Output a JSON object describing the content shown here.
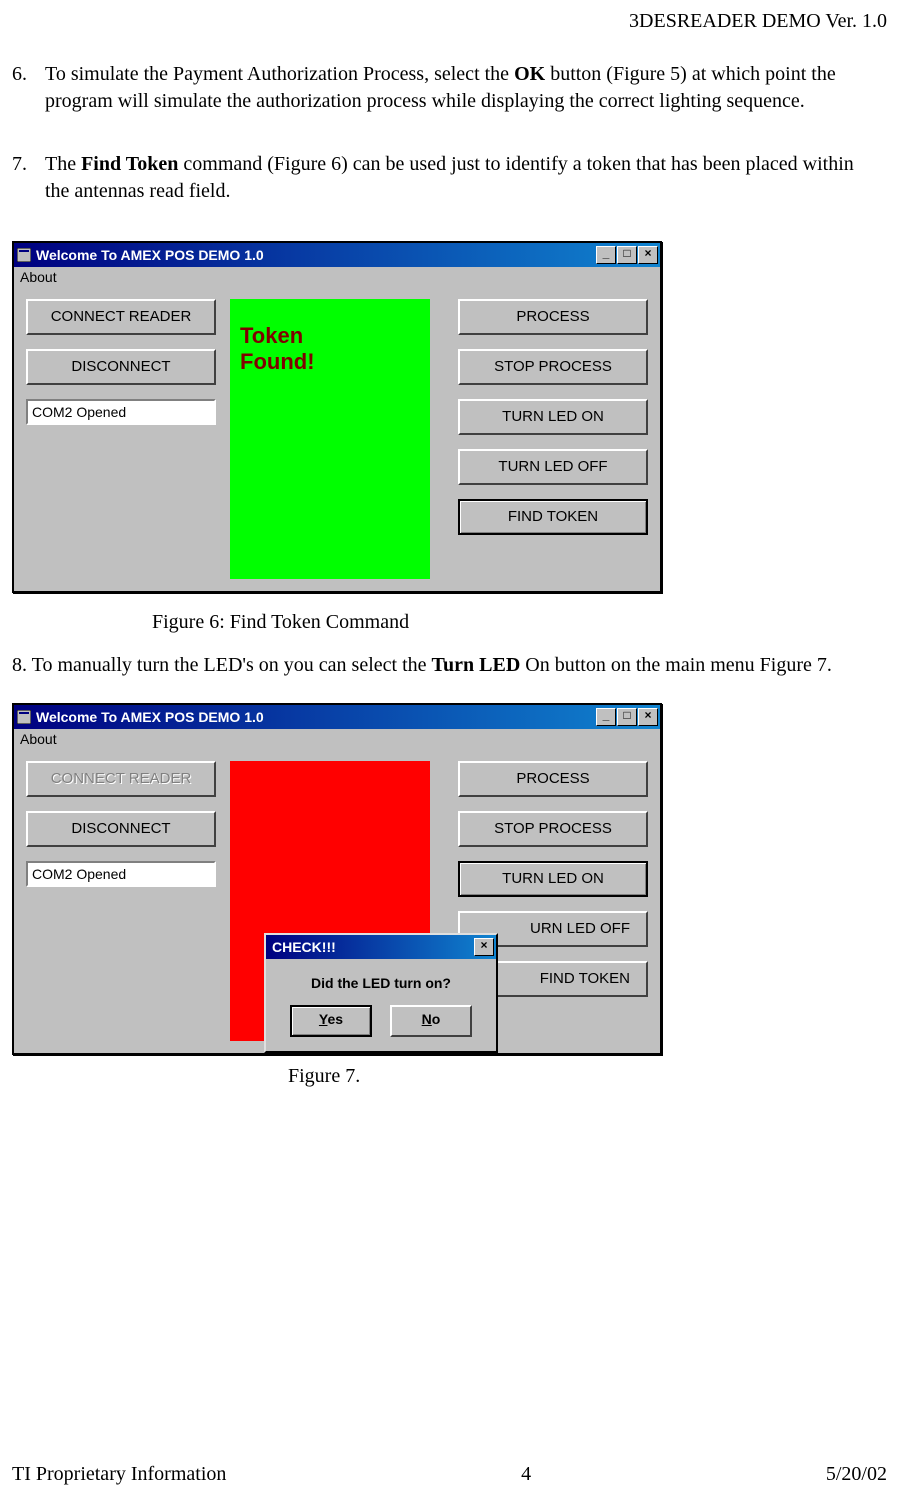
{
  "header": {
    "title": "3DESREADER DEMO Ver. 1.0"
  },
  "items": {
    "i6": {
      "num": "6.",
      "pre": "To simulate the Payment Authorization Process, select the ",
      "bold": "OK",
      "post": " button (Figure 5) at which point the program will simulate the authorization process while displaying the correct lighting sequence."
    },
    "i7": {
      "num": "7.",
      "pre": "The ",
      "bold": "Find Token",
      "post": " command (Figure 6) can be used just to identify a token that has been placed within the antennas read field."
    },
    "i8": {
      "num": "8.",
      "pre": "  To manually turn the LED's on you can select the ",
      "bold": "Turn LED",
      "post": " On button on the main menu Figure 7."
    }
  },
  "fig6": {
    "title": "Welcome To AMEX POS DEMO 1.0",
    "menu_about": "About",
    "left": {
      "connect": "CONNECT READER",
      "disconnect": "DISCONNECT",
      "status": "COM2 Opened"
    },
    "mid_l1": "Token",
    "mid_l2": "Found!",
    "right": {
      "process": "PROCESS",
      "stop": "STOP PROCESS",
      "ledon": "TURN LED ON",
      "ledoff": "TURN LED OFF",
      "find": "FIND TOKEN"
    },
    "caption": "Figure 6: Find Token Command"
  },
  "fig7": {
    "title": "Welcome To AMEX POS DEMO 1.0",
    "menu_about": "About",
    "left": {
      "connect": "CONNECT READER",
      "disconnect": "DISCONNECT",
      "status": "COM2 Opened"
    },
    "right": {
      "process": "PROCESS",
      "stop": "STOP PROCESS",
      "ledon": "TURN LED ON",
      "ledoff": "URN LED OFF",
      "find": "FIND TOKEN"
    },
    "dialog": {
      "title": "CHECK!!!",
      "msg": "Did the LED turn on?",
      "yes_u": "Y",
      "yes_r": "es",
      "no_u": "N",
      "no_r": "o"
    },
    "caption": "Figure 7."
  },
  "footer": {
    "left": "TI Proprietary Information",
    "center": "4",
    "right": "5/20/02"
  },
  "glyphs": {
    "min": "_",
    "max": "□",
    "close": "×"
  }
}
